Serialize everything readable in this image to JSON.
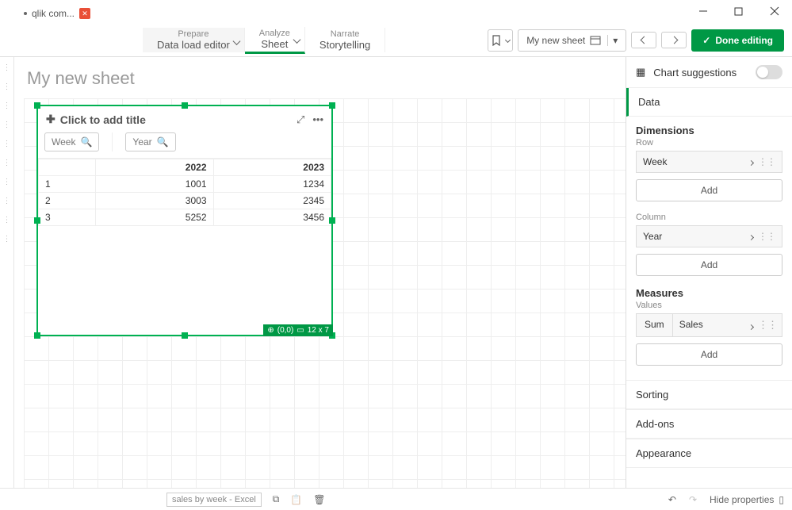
{
  "tab": {
    "label": "qlik com..."
  },
  "nav": {
    "prepare_sup": "Prepare",
    "prepare_main": "Data load editor",
    "analyze_sup": "Analyze",
    "analyze_main": "Sheet",
    "narrate_sup": "Narrate",
    "narrate_main": "Storytelling"
  },
  "toolbar": {
    "sheet_dropdown": "My new sheet",
    "done_editing": "Done editing"
  },
  "sheet": {
    "title": "My new sheet"
  },
  "chart": {
    "title_placeholder": "Click to add title",
    "field_row": "Week",
    "field_col": "Year",
    "headers": {
      "c1": "2022",
      "c2": "2023"
    },
    "rows": [
      {
        "k": "1",
        "c1": "1001",
        "c2": "1234"
      },
      {
        "k": "2",
        "c1": "3003",
        "c2": "2345"
      },
      {
        "k": "3",
        "c1": "5252",
        "c2": "3456"
      }
    ],
    "badge_pos": "(0,0)",
    "badge_size": "12 x 7"
  },
  "panel": {
    "suggestions": "Chart suggestions",
    "data": "Data",
    "dimensions": "Dimensions",
    "row": "Row",
    "row_field": "Week",
    "column": "Column",
    "col_field": "Year",
    "add": "Add",
    "measures": "Measures",
    "values": "Values",
    "agg": "Sum",
    "measure_field": "Sales",
    "sorting": "Sorting",
    "addons": "Add-ons",
    "appearance": "Appearance"
  },
  "bottom": {
    "source": "sales by week - Excel",
    "hide": "Hide properties"
  },
  "chart_data": {
    "type": "table",
    "row_dim": "Week",
    "col_dim": "Year",
    "columns": [
      "2022",
      "2023"
    ],
    "rows": [
      "1",
      "2",
      "3"
    ],
    "values": [
      [
        1001,
        1234
      ],
      [
        3003,
        2345
      ],
      [
        5252,
        3456
      ]
    ],
    "measure": "Sales",
    "aggregation": "Sum"
  }
}
